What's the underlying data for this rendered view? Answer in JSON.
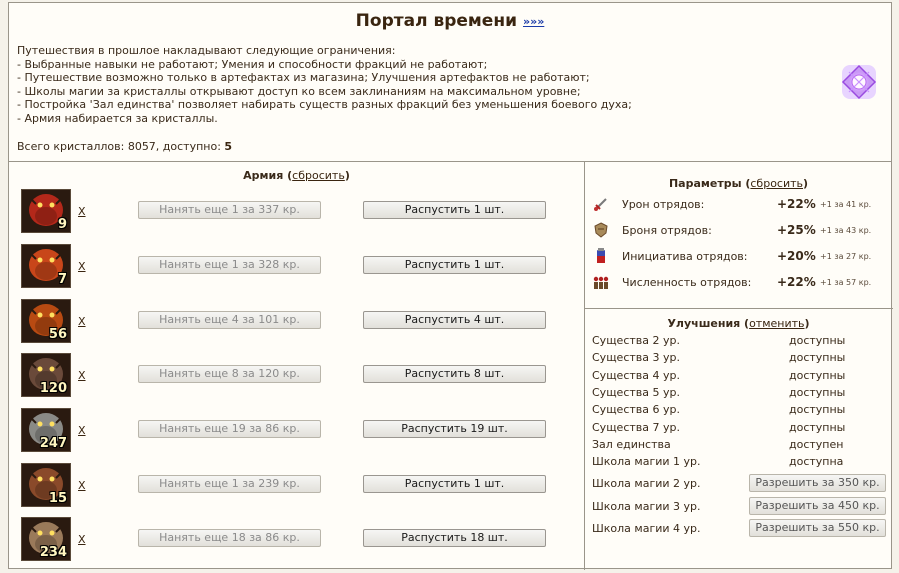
{
  "header": {
    "title": "Портал времени",
    "more_link": "»»»"
  },
  "intro": {
    "lines": [
      "Путешествия в прошлое накладывают следующие ограничения:",
      "- Выбранные навыки не работают; Умения и способности фракций не работают;",
      "- Путешествие возможно только в артефактах из магазина; Улучшения артефактов не работают;",
      "- Школы магии за кристаллы открывают доступ ко всем заклинаниям на максимальном уровне;",
      "- Постройка 'Зал единства' позволяет набирать существ разных фракций без уменьшения боевого духа;",
      "- Армия набирается за кристаллы."
    ],
    "crystals_label": "Всего кристаллов: 8057, доступно: ",
    "crystals_available": "5"
  },
  "army": {
    "title": "Армия",
    "reset_link": "сбросить",
    "remove_label": "X",
    "units": [
      {
        "count": "9",
        "hire": "Нанять еще 1 за 337 кр.",
        "dismiss": "Распустить 1 шт.",
        "color": "#b3281a"
      },
      {
        "count": "7",
        "hire": "Нанять еще 1 за 328 кр.",
        "dismiss": "Распустить 1 шт.",
        "color": "#c8461a"
      },
      {
        "count": "56",
        "hire": "Нанять еще 4 за 101 кр.",
        "dismiss": "Распустить 4 шт.",
        "color": "#b84a12"
      },
      {
        "count": "120",
        "hire": "Нанять еще 8 за 120 кр.",
        "dismiss": "Распустить 8 шт.",
        "color": "#6a4a3a"
      },
      {
        "count": "247",
        "hire": "Нанять еще 19 за 86 кр.",
        "dismiss": "Распустить 19 шт.",
        "color": "#8a8a86"
      },
      {
        "count": "15",
        "hire": "Нанять еще 1 за 239 кр.",
        "dismiss": "Распустить 1 шт.",
        "color": "#8a4a2a"
      },
      {
        "count": "234",
        "hire": "Нанять еще 18 за 86 кр.",
        "dismiss": "Распустить 18 шт.",
        "color": "#9a7a5a"
      }
    ]
  },
  "params": {
    "title": "Параметры",
    "reset_link": "сбросить",
    "items": [
      {
        "icon": "sword-icon",
        "name": "Урон отрядов:",
        "value": "+22%",
        "cost": "+1 за 41 кр."
      },
      {
        "icon": "shield-icon",
        "name": "Броня отрядов:",
        "value": "+25%",
        "cost": "+1 за 43 кр."
      },
      {
        "icon": "potion-icon",
        "name": "Инициатива отрядов:",
        "value": "+20%",
        "cost": "+1 за 27 кр."
      },
      {
        "icon": "troops-icon",
        "name": "Численность отрядов:",
        "value": "+22%",
        "cost": "+1 за 57 кр."
      }
    ]
  },
  "upgrades": {
    "title": "Улучшения",
    "cancel_link": "отменить",
    "items": [
      {
        "name": "Существа 2 ур.",
        "status": "доступны"
      },
      {
        "name": "Существа 3 ур.",
        "status": "доступны"
      },
      {
        "name": "Существа 4 ур.",
        "status": "доступны"
      },
      {
        "name": "Существа 5 ур.",
        "status": "доступны"
      },
      {
        "name": "Существа 6 ур.",
        "status": "доступны"
      },
      {
        "name": "Существа 7 ур.",
        "status": "доступны"
      },
      {
        "name": "Зал единства",
        "status": "доступен"
      },
      {
        "name": "Школа магии 1 ур.",
        "status": "доступна"
      }
    ],
    "allow_items": [
      {
        "name": "Школа магии 2 ур.",
        "button": "Разрешить за 350 кр."
      },
      {
        "name": "Школа магии 3 ур.",
        "button": "Разрешить за 450 кр."
      },
      {
        "name": "Школа магии 4 ур.",
        "button": "Разрешить за 550 кр."
      }
    ]
  }
}
